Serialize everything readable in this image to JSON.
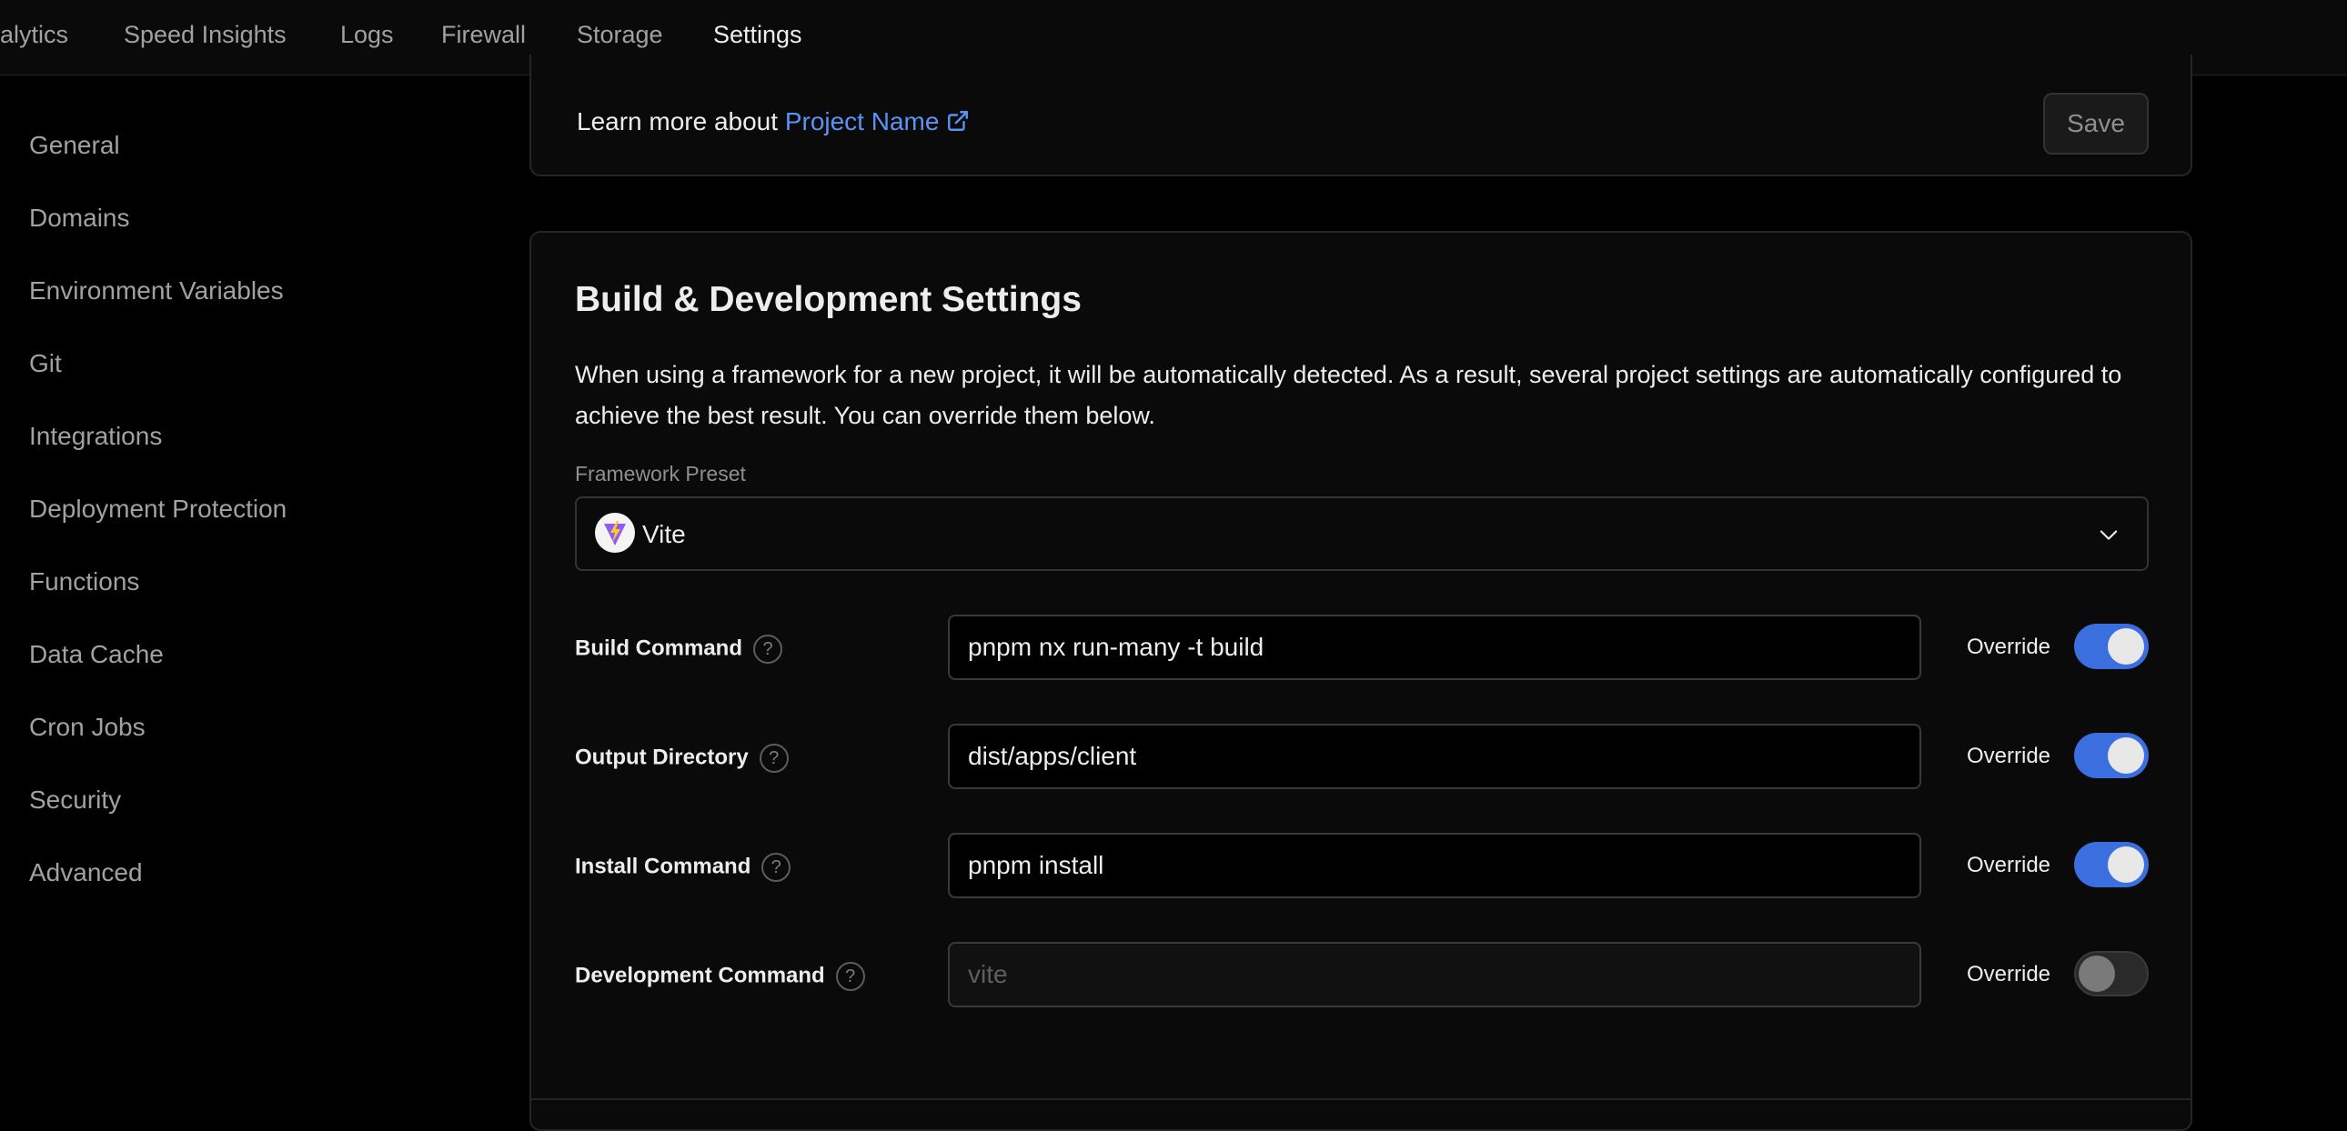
{
  "topnav": {
    "tabs": [
      {
        "label": "alytics"
      },
      {
        "label": "Speed Insights"
      },
      {
        "label": "Logs"
      },
      {
        "label": "Firewall"
      },
      {
        "label": "Storage"
      },
      {
        "label": "Settings"
      }
    ],
    "active_tab": "Settings"
  },
  "sidebar": {
    "items": [
      {
        "label": "General"
      },
      {
        "label": "Domains"
      },
      {
        "label": "Environment Variables"
      },
      {
        "label": "Git"
      },
      {
        "label": "Integrations"
      },
      {
        "label": "Deployment Protection"
      },
      {
        "label": "Functions"
      },
      {
        "label": "Data Cache"
      },
      {
        "label": "Cron Jobs"
      },
      {
        "label": "Security"
      },
      {
        "label": "Advanced"
      }
    ]
  },
  "top_card": {
    "learn_prefix": "Learn more about ",
    "learn_link": "Project Name",
    "save_label": "Save"
  },
  "build_settings": {
    "title": "Build & Development Settings",
    "description": "When using a framework for a new project, it will be automatically detected. As a result, several project settings are automatically configured to achieve the best result. You can override them below.",
    "framework_label": "Framework Preset",
    "framework_value": "Vite",
    "override_label": "Override",
    "rows": [
      {
        "label": "Build Command",
        "value": "pnpm nx run-many -t build",
        "placeholder": "",
        "override": true
      },
      {
        "label": "Output Directory",
        "value": "dist/apps/client",
        "placeholder": "",
        "override": true
      },
      {
        "label": "Install Command",
        "value": "pnpm install",
        "placeholder": "",
        "override": true
      },
      {
        "label": "Development Command",
        "value": "",
        "placeholder": "vite",
        "override": false
      }
    ],
    "help_glyph": "?"
  },
  "colors": {
    "background": "#000000",
    "card": "#0a0a0a",
    "link": "#5b93f5",
    "toggle_on": "#3b6fe0"
  }
}
